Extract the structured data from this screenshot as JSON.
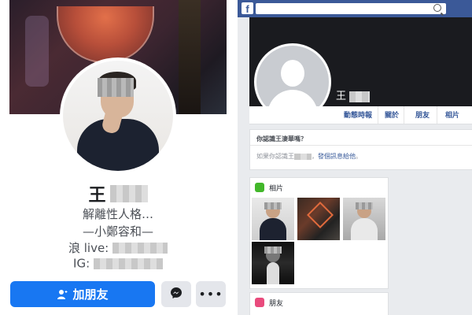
{
  "mobile": {
    "name": "王",
    "bio_line1": "解離性人格…",
    "bio_line2": "—小鄭容和—",
    "bio_line3_label": "浪 live:",
    "bio_line4_label": "IG:",
    "add_friend_label": "加朋友",
    "icons": {
      "add_friend": "add-person-icon",
      "messenger": "messenger-icon",
      "more": "more-icon"
    },
    "colors": {
      "primary_button": "#1877f2",
      "secondary_button": "#e4e6eb"
    }
  },
  "desktop": {
    "logo": "f",
    "search_placeholder": "",
    "name": "王",
    "tabs": [
      "動態時報",
      "關於",
      "朋友",
      "相片"
    ],
    "know_question": "你認識王淒華嗎？",
    "know_message_prefix": "如果你認識王",
    "know_message_link": "發個訊息給他",
    "know_message_suffix": "。",
    "photos_title": "相片",
    "friends_title": "朋友",
    "colors": {
      "topbar": "#3b5998",
      "link": "#365899",
      "photos_icon": "#42b72a",
      "friends_icon": "#e94b7d"
    }
  }
}
